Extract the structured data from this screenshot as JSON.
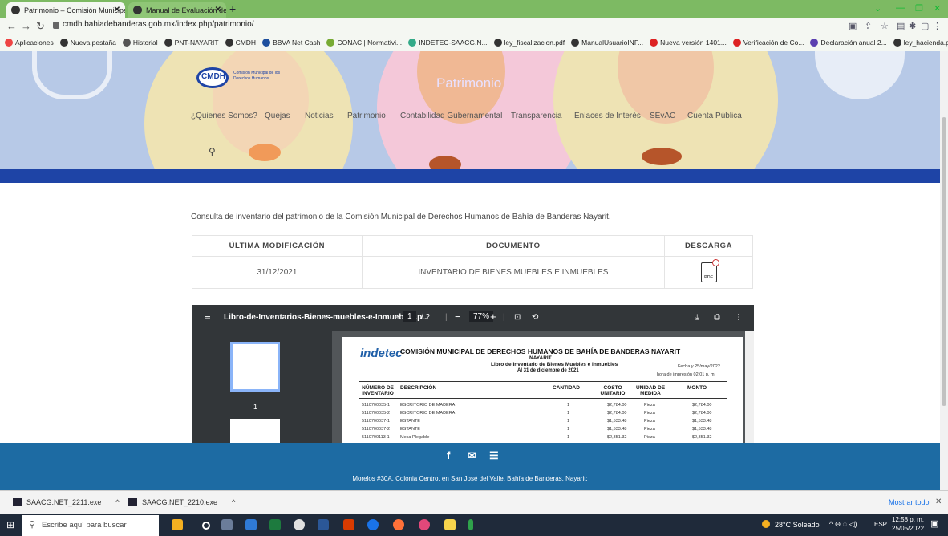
{
  "browser": {
    "tabs": [
      {
        "title": "Patrimonio – Comisión Municipa",
        "active": true
      },
      {
        "title": "Manual de Evaluación de Avance",
        "active": false
      }
    ],
    "url": "cmdh.bahiadebanderas.gob.mx/index.php/patrimonio/",
    "bookmarks": [
      {
        "label": "Aplicaciones",
        "color": "#e44"
      },
      {
        "label": "Nueva pestaña",
        "color": "#333"
      },
      {
        "label": "Historial",
        "color": "#555"
      },
      {
        "label": "PNT-NAYARIT",
        "color": "#333"
      },
      {
        "label": "CMDH",
        "color": "#333"
      },
      {
        "label": "BBVA Net Cash",
        "color": "#1d4f9e"
      },
      {
        "label": "CONAC | Normativi...",
        "color": "#7a3"
      },
      {
        "label": "INDETEC-SAACG.N...",
        "color": "#3a8"
      },
      {
        "label": "ley_fiscalizacion.pdf",
        "color": "#333"
      },
      {
        "label": "ManualUsuarioINF...",
        "color": "#333"
      },
      {
        "label": "Nueva versión 1401...",
        "color": "#d22"
      },
      {
        "label": "Verificación de Co...",
        "color": "#d22"
      },
      {
        "label": "Declaración anual 2...",
        "color": "#5a3fb0"
      },
      {
        "label": "ley_hacienda.pdf",
        "color": "#333"
      }
    ]
  },
  "site": {
    "logo_text": "CMDH",
    "logo_sub": "Comisión Municipal de los Derechos Humanos",
    "hero_title": "Patrimonio",
    "nav": [
      "¿Quienes Somos?",
      "Quejas",
      "Noticias",
      "Patrimonio",
      "Contabilidad Gubernamental",
      "Transparencia",
      "Enlaces de Interés",
      "SEvAC",
      "Cuenta Pública"
    ],
    "intro": "Consulta de inventario del patrimonio de la Comisión Municipal de Derechos Humanos de Bahía de Banderas Nayarit.",
    "table": {
      "headers": [
        "ÚLTIMA MODIFICACIÓN",
        "DOCUMENTO",
        "DESCARGA"
      ],
      "rows": [
        {
          "date": "31/12/2021",
          "document": "INVENTARIO DE BIENES MUEBLES E INMUEBLES",
          "download": "PDF"
        }
      ]
    }
  },
  "viewer": {
    "filename": "Libro-de-Inventarios-Bienes-muebles-e-Inmuebles.p...",
    "page": "1",
    "pages": "/ 2",
    "zoom": "77%",
    "thumb_label": "1",
    "doc": {
      "brand": "indetec",
      "title": "COMISIÓN MUNICIPAL DE DERECHOS HUMANOS DE BAHÍA DE BANDERAS NAYARIT",
      "state": "NAYARIT",
      "subtitle": "Libro de Inventario de Bienes Muebles e Inmuebles",
      "date_line": "Al 31 de diciembre de 2021",
      "fecha": "Fecha y 25/may/2022",
      "hora": "hora de impresión 02:01 p. m.",
      "columns": [
        "NÚMERO DE INVENTARIO",
        "DESCRIPCIÓN",
        "CANTIDAD",
        "COSTO UNITARIO",
        "UNIDAD DE MEDIDA",
        "MONTO"
      ],
      "rows": [
        [
          "5110700035-1",
          "ESCRITORIO DE MADERA",
          "1",
          "$2,784.00",
          "Pieza",
          "$2,784.00"
        ],
        [
          "5110700035-2",
          "ESCRITORIO DE MADERA",
          "1",
          "$2,784.00",
          "Pieza",
          "$2,784.00"
        ],
        [
          "5110700037-1",
          "ESTANTE",
          "1",
          "$1,533.48",
          "Pieza",
          "$1,533.48"
        ],
        [
          "5110700037-2",
          "ESTANTE",
          "1",
          "$1,533.48",
          "Pieza",
          "$1,533.48"
        ],
        [
          "5110700113-1",
          "Mesa Plegable",
          "1",
          "$2,351.32",
          "Pieza",
          "$2,351.32"
        ]
      ]
    }
  },
  "footer": {
    "address": "Morelos #30A, Colonia Centro, en San José del Valle, Bahía de Banderas, Nayarit;"
  },
  "downloads": {
    "items": [
      "SAACG.NET_2211.exe",
      "SAACG.NET_2210.exe"
    ],
    "show_all": "Mostrar todo"
  },
  "taskbar": {
    "search_placeholder": "Escribe aquí para buscar",
    "weather": "28°C Soleado",
    "lang": "ESP",
    "time": "12:58 p. m.",
    "date": "25/05/2022"
  }
}
